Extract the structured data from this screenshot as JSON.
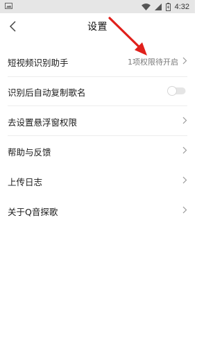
{
  "status_bar": {
    "time": "4:32",
    "icons": [
      "image-icon",
      "wifi-icon",
      "signal-icon",
      "battery-icon"
    ]
  },
  "header": {
    "title": "设置",
    "back_icon": "chevron-left-icon"
  },
  "settings": {
    "items": [
      {
        "label": "短视频识别助手",
        "value": "1项权限待开启",
        "control": "chevron"
      },
      {
        "label": "识别后自动复制歌名",
        "control": "toggle",
        "toggle_on": false
      },
      {
        "label": "去设置悬浮窗权限",
        "control": "chevron"
      },
      {
        "label": "帮助与反馈",
        "control": "chevron"
      },
      {
        "label": "上传日志",
        "control": "chevron"
      },
      {
        "label": "关于Q音探歌",
        "control": "chevron"
      }
    ]
  },
  "colors": {
    "annotation_arrow": "#e0201b",
    "status_bar_bg": "#e6e6e6"
  }
}
